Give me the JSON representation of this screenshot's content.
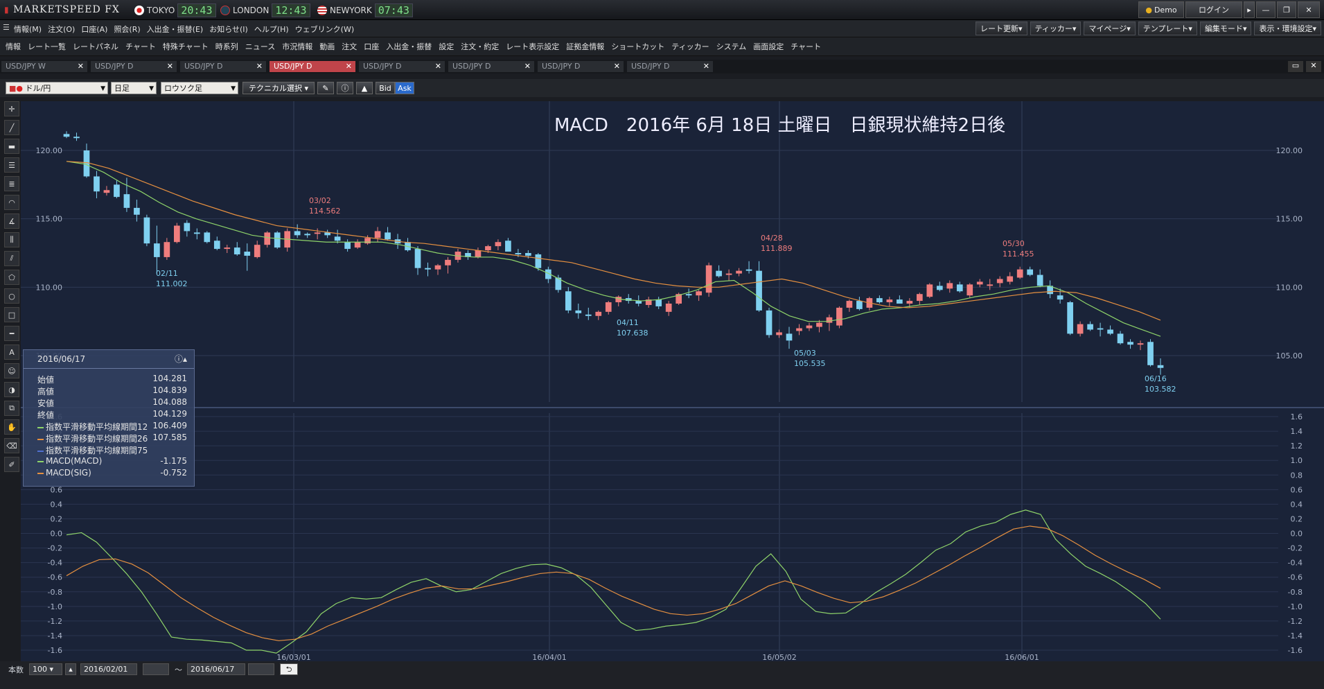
{
  "app": {
    "logo": "MARKETSPEED FX",
    "demo": "Demo",
    "login": "ログイン",
    "clocks": [
      {
        "city": "TOKYO",
        "time": "20:43"
      },
      {
        "city": "LONDON",
        "time": "12:43"
      },
      {
        "city": "NEWYORK",
        "time": "07:43"
      }
    ]
  },
  "menu": [
    "情報(M)",
    "注文(O)",
    "口座(A)",
    "照会(R)",
    "入出金・振替(E)",
    "お知らせ(I)",
    "ヘルプ(H)",
    "ウェブリンク(W)"
  ],
  "menu_right": [
    "レート更新",
    "ティッカー",
    "マイページ",
    "テンプレート",
    "編集モード",
    "表示・環境設定"
  ],
  "toolbar": [
    "情報",
    "レート一覧",
    "レートパネル",
    "チャート",
    "特殊チャート",
    "時系列",
    "ニュース",
    "市況情報",
    "動画",
    "注文",
    "口座",
    "入出金・振替",
    "設定",
    "注文・約定",
    "レート表示設定",
    "証拠金情報",
    "ショートカット",
    "ティッカー",
    "システム",
    "画面設定",
    "チャート"
  ],
  "tabs": [
    "USD/JPY W",
    "USD/JPY D",
    "USD/JPY D",
    "USD/JPY D",
    "USD/JPY D",
    "USD/JPY D",
    "USD/JPY D",
    "USD/JPY D"
  ],
  "controls": {
    "pair": "ドル/円",
    "period": "日足",
    "type": "ロウソク足",
    "tech": "テクニカル選択",
    "bid": "Bid",
    "ask": "Ask"
  },
  "chart_title": "MACD　2016年 6月 18日 土曜日　日銀現状維持2日後",
  "info_panel": {
    "date": "2016/06/17",
    "rows": [
      {
        "label": "始値",
        "value": "104.281"
      },
      {
        "label": "高値",
        "value": "104.839"
      },
      {
        "label": "安値",
        "value": "104.088"
      },
      {
        "label": "終値",
        "value": "104.129"
      },
      {
        "label": "指数平滑移動平均線期間12",
        "value": "106.409",
        "color": "#8fd46a"
      },
      {
        "label": "指数平滑移動平均線期間26",
        "value": "107.585",
        "color": "#e69040"
      },
      {
        "label": "指数平滑移動平均線期間75",
        "value": "",
        "color": "#5070d0"
      },
      {
        "label": "MACD(MACD)",
        "value": "-1.175",
        "color": "#8fd46a"
      },
      {
        "label": "MACD(SIG)",
        "value": "-0.752",
        "color": "#e69040"
      }
    ]
  },
  "bottom": {
    "count_label": "本数",
    "count": "100",
    "from": "2016/02/01",
    "tilde": "～",
    "to": "2016/06/17"
  },
  "chart_data": {
    "type": "candlestick",
    "price_ticks": [
      "120.00",
      "115.00",
      "110.00",
      "105.00"
    ],
    "macd_ticks": [
      "1.6",
      "1.4",
      "1.2",
      "1.0",
      "0.8",
      "0.6",
      "0.4",
      "0.2",
      "0.0",
      "-0.2",
      "-0.4",
      "-0.6",
      "-0.8",
      "-1.0",
      "-1.2",
      "-1.4",
      "-1.6"
    ],
    "x_labels": [
      "16/03/01",
      "16/04/01",
      "16/05/02",
      "16/06/01"
    ],
    "annotations": [
      {
        "date": "02/11",
        "price": "111.002"
      },
      {
        "date": "03/02",
        "price": "114.562"
      },
      {
        "date": "04/11",
        "price": "107.638"
      },
      {
        "date": "04/28",
        "price": "111.889"
      },
      {
        "date": "05/03",
        "price": "105.535"
      },
      {
        "date": "05/30",
        "price": "111.455"
      },
      {
        "date": "06/16",
        "price": "103.582"
      }
    ],
    "candles": [
      [
        121.2,
        121.4,
        120.9,
        121.0
      ],
      [
        121.0,
        121.3,
        120.7,
        120.9
      ],
      [
        120.0,
        120.5,
        118.0,
        118.1
      ],
      [
        118.1,
        118.5,
        116.5,
        117.0
      ],
      [
        116.9,
        117.4,
        116.7,
        117.1
      ],
      [
        117.5,
        117.8,
        116.5,
        116.6
      ],
      [
        116.8,
        118.0,
        115.5,
        115.8
      ],
      [
        115.8,
        116.4,
        114.8,
        115.3
      ],
      [
        115.1,
        115.3,
        113.0,
        113.2
      ],
      [
        113.2,
        114.5,
        111.0,
        112.2
      ],
      [
        112.2,
        113.6,
        112.0,
        113.3
      ],
      [
        113.3,
        114.7,
        113.2,
        114.5
      ],
      [
        114.7,
        114.9,
        113.7,
        114.1
      ],
      [
        114.0,
        114.3,
        113.5,
        113.9
      ],
      [
        114.0,
        114.1,
        113.2,
        113.3
      ],
      [
        113.4,
        113.7,
        112.7,
        112.8
      ],
      [
        112.8,
        113.1,
        112.5,
        112.9
      ],
      [
        112.9,
        113.3,
        112.3,
        112.4
      ],
      [
        112.6,
        113.2,
        111.2,
        112.3
      ],
      [
        112.2,
        113.4,
        112.1,
        113.1
      ],
      [
        113.1,
        114.1,
        112.9,
        114.0
      ],
      [
        114.0,
        114.1,
        112.8,
        112.9
      ],
      [
        112.9,
        114.3,
        112.6,
        114.1
      ],
      [
        114.1,
        114.6,
        113.6,
        113.8
      ],
      [
        113.9,
        114.0,
        113.6,
        113.8
      ],
      [
        113.9,
        114.3,
        113.5,
        114.0
      ],
      [
        114.0,
        114.2,
        113.6,
        113.8
      ],
      [
        113.7,
        114.2,
        113.2,
        113.4
      ],
      [
        113.3,
        113.5,
        112.6,
        112.8
      ],
      [
        112.9,
        113.5,
        112.8,
        113.3
      ],
      [
        113.2,
        113.8,
        113.1,
        113.6
      ],
      [
        113.6,
        114.4,
        113.3,
        114.1
      ],
      [
        114.0,
        114.4,
        113.4,
        113.5
      ],
      [
        113.5,
        113.9,
        112.8,
        113.2
      ],
      [
        113.3,
        113.6,
        112.6,
        112.7
      ],
      [
        112.8,
        113.0,
        110.9,
        111.4
      ],
      [
        111.4,
        111.8,
        110.8,
        111.3
      ],
      [
        111.3,
        111.7,
        110.9,
        111.6
      ],
      [
        111.6,
        112.2,
        111.0,
        112.0
      ],
      [
        112.0,
        112.8,
        111.8,
        112.6
      ],
      [
        112.5,
        112.7,
        112.0,
        112.2
      ],
      [
        112.2,
        112.9,
        112.1,
        112.7
      ],
      [
        112.7,
        113.1,
        112.5,
        113.0
      ],
      [
        113.0,
        113.5,
        112.7,
        113.3
      ],
      [
        113.4,
        113.6,
        112.6,
        112.6
      ],
      [
        112.5,
        112.8,
        112.2,
        112.4
      ],
      [
        112.5,
        112.7,
        112.1,
        112.3
      ],
      [
        112.4,
        112.5,
        111.2,
        111.4
      ],
      [
        111.3,
        111.5,
        110.3,
        110.6
      ],
      [
        110.7,
        110.9,
        109.6,
        109.8
      ],
      [
        109.7,
        110.0,
        108.1,
        108.3
      ],
      [
        108.3,
        108.8,
        107.7,
        108.1
      ],
      [
        108.0,
        108.5,
        107.6,
        107.9
      ],
      [
        107.9,
        108.3,
        107.6,
        108.2
      ],
      [
        108.2,
        109.0,
        108.0,
        108.9
      ],
      [
        108.9,
        109.4,
        108.6,
        109.3
      ],
      [
        109.2,
        109.5,
        108.8,
        109.0
      ],
      [
        109.0,
        109.4,
        108.6,
        108.8
      ],
      [
        108.7,
        109.3,
        108.5,
        109.1
      ],
      [
        109.1,
        109.3,
        108.4,
        108.6
      ],
      [
        108.2,
        109.0,
        107.9,
        108.8
      ],
      [
        108.8,
        109.6,
        108.7,
        109.5
      ],
      [
        109.5,
        109.9,
        109.2,
        109.4
      ],
      [
        109.4,
        109.8,
        109.0,
        109.7
      ],
      [
        109.6,
        111.8,
        109.3,
        111.6
      ],
      [
        111.2,
        111.6,
        110.7,
        110.8
      ],
      [
        110.9,
        111.3,
        110.5,
        111.0
      ],
      [
        111.0,
        111.4,
        110.8,
        111.2
      ],
      [
        111.3,
        111.9,
        111.0,
        111.2
      ],
      [
        111.2,
        111.9,
        108.2,
        108.3
      ],
      [
        108.3,
        108.5,
        106.3,
        106.5
      ],
      [
        106.5,
        106.9,
        106.3,
        106.7
      ],
      [
        106.6,
        107.1,
        105.5,
        106.1
      ],
      [
        106.8,
        107.3,
        106.5,
        107.0
      ],
      [
        107.0,
        107.4,
        106.8,
        107.2
      ],
      [
        107.1,
        107.6,
        106.7,
        107.4
      ],
      [
        107.4,
        108.0,
        106.8,
        107.8
      ],
      [
        107.2,
        108.6,
        107.0,
        108.5
      ],
      [
        108.5,
        109.1,
        108.2,
        109.0
      ],
      [
        109.0,
        109.3,
        108.3,
        108.4
      ],
      [
        108.5,
        109.3,
        108.3,
        109.2
      ],
      [
        109.2,
        109.4,
        108.8,
        108.9
      ],
      [
        108.9,
        109.3,
        108.6,
        109.1
      ],
      [
        109.1,
        109.4,
        108.8,
        108.8
      ],
      [
        108.8,
        109.2,
        108.5,
        109.0
      ],
      [
        109.0,
        109.6,
        108.7,
        109.5
      ],
      [
        109.3,
        110.3,
        109.2,
        110.2
      ],
      [
        110.1,
        110.4,
        109.7,
        109.8
      ],
      [
        109.9,
        110.5,
        109.6,
        110.3
      ],
      [
        110.2,
        110.4,
        109.6,
        109.7
      ],
      [
        109.4,
        110.3,
        109.2,
        110.2
      ],
      [
        110.2,
        110.6,
        110.0,
        110.4
      ],
      [
        110.1,
        110.6,
        109.8,
        110.2
      ],
      [
        110.3,
        110.8,
        110.0,
        110.6
      ],
      [
        110.4,
        111.1,
        110.2,
        110.8
      ],
      [
        110.7,
        111.5,
        110.6,
        111.3
      ],
      [
        111.3,
        111.5,
        110.8,
        110.9
      ],
      [
        110.9,
        111.3,
        110.0,
        110.1
      ],
      [
        110.1,
        110.5,
        109.2,
        109.5
      ],
      [
        109.4,
        109.9,
        108.8,
        109.1
      ],
      [
        108.9,
        109.0,
        106.5,
        106.6
      ],
      [
        106.6,
        107.5,
        106.4,
        107.3
      ],
      [
        107.3,
        107.5,
        106.8,
        106.9
      ],
      [
        107.0,
        107.4,
        106.4,
        106.9
      ],
      [
        106.9,
        107.2,
        106.5,
        106.6
      ],
      [
        106.6,
        106.8,
        105.8,
        105.9
      ],
      [
        106.0,
        106.2,
        105.5,
        105.8
      ],
      [
        105.8,
        106.1,
        105.4,
        105.9
      ],
      [
        106.0,
        106.2,
        104.2,
        104.3
      ],
      [
        104.3,
        104.8,
        103.6,
        104.1
      ]
    ],
    "macd": [
      -0.02,
      0.01,
      -0.12,
      -0.33,
      -0.55,
      -0.8,
      -1.1,
      -1.42,
      -1.45,
      -1.46,
      -1.48,
      -1.5,
      -1.6,
      -1.6,
      -1.64,
      -1.5,
      -1.35,
      -1.1,
      -0.96,
      -0.88,
      -0.9,
      -0.88,
      -0.77,
      -0.67,
      -0.62,
      -0.72,
      -0.8,
      -0.77,
      -0.66,
      -0.55,
      -0.48,
      -0.43,
      -0.42,
      -0.47,
      -0.57,
      -0.74,
      -0.98,
      -1.22,
      -1.33,
      -1.31,
      -1.27,
      -1.25,
      -1.22,
      -1.15,
      -1.04,
      -0.75,
      -0.45,
      -0.28,
      -0.52,
      -0.9,
      -1.07,
      -1.1,
      -1.09,
      -0.96,
      -0.81,
      -0.69,
      -0.56,
      -0.4,
      -0.23,
      -0.14,
      0.02,
      0.1,
      0.15,
      0.26,
      0.32,
      0.26,
      -0.08,
      -0.28,
      -0.45,
      -0.55,
      -0.66,
      -0.8,
      -0.96,
      -1.175
    ],
    "signal": [
      -0.58,
      -0.45,
      -0.36,
      -0.35,
      -0.42,
      -0.54,
      -0.71,
      -0.88,
      -1.02,
      -1.15,
      -1.26,
      -1.36,
      -1.43,
      -1.47,
      -1.45,
      -1.38,
      -1.27,
      -1.18,
      -1.09,
      -1.0,
      -0.9,
      -0.82,
      -0.75,
      -0.72,
      -0.76,
      -0.76,
      -0.71,
      -0.66,
      -0.6,
      -0.55,
      -0.53,
      -0.55,
      -0.63,
      -0.75,
      -0.86,
      -0.95,
      -1.04,
      -1.1,
      -1.12,
      -1.1,
      -1.04,
      -0.96,
      -0.84,
      -0.72,
      -0.65,
      -0.72,
      -0.81,
      -0.89,
      -0.95,
      -0.93,
      -0.87,
      -0.78,
      -0.68,
      -0.56,
      -0.44,
      -0.31,
      -0.19,
      -0.06,
      0.06,
      0.1,
      0.07,
      -0.03,
      -0.16,
      -0.3,
      -0.42,
      -0.53,
      -0.63,
      -0.752
    ],
    "ema12": [
      119.2,
      119.0,
      118.4,
      117.6,
      117.0,
      116.2,
      115.5,
      115.0,
      114.6,
      114.2,
      113.8,
      113.6,
      113.5,
      113.4,
      113.3,
      113.3,
      113.3,
      113.3,
      113.1,
      112.8,
      112.5,
      112.3,
      112.2,
      112.2,
      112.0,
      111.6,
      111.0,
      110.3,
      109.8,
      109.4,
      109.1,
      109.0,
      109.1,
      109.4,
      109.8,
      110.4,
      110.5,
      109.6,
      108.6,
      107.9,
      107.5,
      107.5,
      107.7,
      108.1,
      108.4,
      108.5,
      108.7,
      108.8,
      109.0,
      109.3,
      109.5,
      109.8,
      110.0,
      110.1,
      109.6,
      108.8,
      108.1,
      107.4,
      106.9,
      106.409
    ],
    "ema26": [
      119.2,
      119.1,
      118.7,
      118.1,
      117.5,
      116.9,
      116.3,
      115.8,
      115.3,
      114.9,
      114.5,
      114.3,
      114.1,
      113.9,
      113.7,
      113.5,
      113.3,
      113.2,
      113.0,
      112.8,
      112.6,
      112.4,
      112.2,
      112.0,
      111.8,
      111.4,
      111.0,
      110.6,
      110.3,
      110.1,
      110.0,
      110.0,
      110.2,
      110.4,
      110.6,
      110.3,
      109.8,
      109.3,
      108.9,
      108.6,
      108.5,
      108.6,
      108.8,
      109.0,
      109.2,
      109.4,
      109.6,
      109.7,
      109.6,
      109.2,
      108.7,
      108.2,
      107.585
    ]
  }
}
